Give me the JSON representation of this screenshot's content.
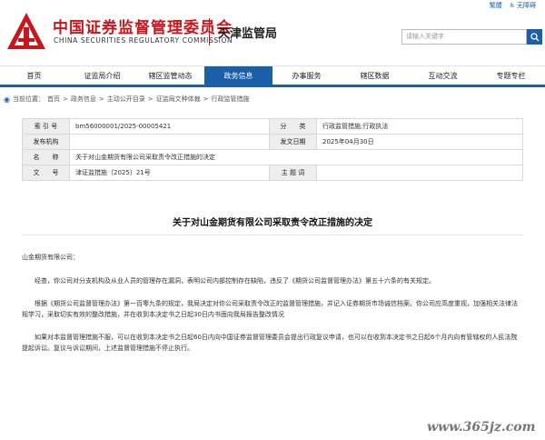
{
  "util": {
    "simplified": "繁體",
    "accessible": "无障碍"
  },
  "header": {
    "brand_cn": "中国证券监督管理委员会",
    "brand_en": "CHINA SECURITIES REGULATORY COMMISSION",
    "sub": "天津监管局",
    "search_placeholder": "请输入关键字",
    "brand_color": "#c8161d",
    "accent_color": "#1a5fa8"
  },
  "nav": [
    {
      "label": "首页"
    },
    {
      "label": "证监局介绍"
    },
    {
      "label": "辖区监管动态"
    },
    {
      "label": "政务信息",
      "active": true
    },
    {
      "label": "办事服务"
    },
    {
      "label": "辖区数据"
    },
    {
      "label": "互动交流"
    },
    {
      "label": "专题专栏"
    }
  ],
  "breadcrumb": {
    "prefix": "当前位置：",
    "items": [
      "首页",
      "政务信息",
      "主动公开目录",
      "证监局文种体裁",
      "行政监管措施"
    ],
    "sep": ">"
  },
  "meta": {
    "index_label": "索 引 号",
    "index_value": "bm56000001/2025-00005421",
    "category_label": "分　　类",
    "category_value": "行政监管措施;行政执法",
    "issuer_label": "发布机构",
    "issuer_value": "",
    "date_label": "发文日期",
    "date_value": "2025年04月30日",
    "name_label": "名　　称",
    "name_value": "关于对山金期货有限公司采取责令改正措施的决定",
    "docno_label": "文　　号",
    "docno_value": "津证监措施〔2025〕21号",
    "subject_label": "主 题 词",
    "subject_value": ""
  },
  "doc": {
    "title": "关于对山金期货有限公司采取责令改正措施的决定",
    "salutation": "山金期货有限公司：",
    "p1": "经查，你公司对分支机构及从业人员的管理存在漏洞，表明公司内部控制存在缺陷，违反了《期货公司监督管理办法》第五十六条的有关规定。",
    "p2": "根据《期货公司监督管理办法》第一百零九条的规定，我局决定对你公司采取责令改正的监督管理措施，并记入证券期货市场诚信档案。你公司应高度重视，加强相关法律法规学习，采取切实有效的整改措施，并在收到本决定书之日起30日内书面向我局报告整改情况",
    "p3": "如果对本监督管理措施不服，可以在收到本决定书之日起60日内向中国证券监督管理委员会提出行政复议申请，也可以在收到本决定书之日起6个月内向有管辖权的人民法院提起诉讼。复议与诉讼期间，上述监督管理措施不停止执行。"
  },
  "watermark": "www.365jz.com"
}
